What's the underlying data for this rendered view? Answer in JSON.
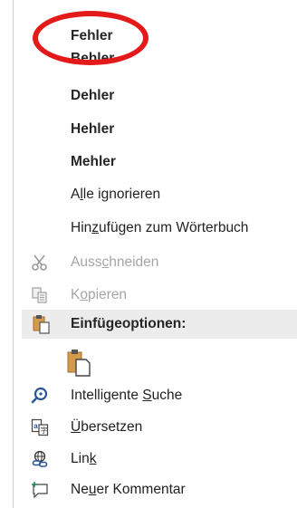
{
  "spelling": {
    "suggestions": [
      "Fehler",
      "Behler",
      "Dehler",
      "Hehler",
      "Mehler"
    ]
  },
  "menu": {
    "ignore_all": {
      "pre": "A",
      "acc": "l",
      "post": "le ignorieren"
    },
    "add_dictionary": {
      "pre": "Hin",
      "acc": "z",
      "post": "ufügen zum Wörterbuch"
    },
    "cut": {
      "pre": "Auss",
      "acc": "c",
      "post": "hneiden"
    },
    "copy": {
      "pre": "K",
      "acc": "o",
      "post": "pieren"
    },
    "paste_options": "Einfügeoptionen:",
    "smart_lookup": {
      "pre": "Intelligente ",
      "acc": "S",
      "post": "uche"
    },
    "translate": {
      "pre": "",
      "acc": "Ü",
      "post": "bersetzen"
    },
    "link": {
      "pre": "Lin",
      "acc": "k",
      "post": ""
    },
    "new_comment": {
      "pre": "Ne",
      "acc": "u",
      "post": "er Kommentar"
    }
  },
  "colors": {
    "highlight_circle": "#e41a1a",
    "accent_blue": "#2b579a",
    "paste_orange": "#d39b4a"
  },
  "icons": [
    "scissors-icon",
    "copy-icon",
    "paste-icon",
    "paste-keep-format-icon",
    "smart-lookup-icon",
    "translate-icon",
    "link-icon",
    "new-comment-icon"
  ]
}
